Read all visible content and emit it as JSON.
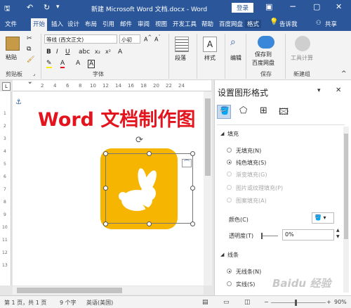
{
  "titlebar": {
    "title": "新建 Microsoft Word 文档.docx - Word",
    "login": "登录",
    "minimize_icon": "minimize-icon",
    "restore_icon": "restore-icon",
    "close_icon": "close-icon"
  },
  "tabs": [
    "文件",
    "开始",
    "插入",
    "设计",
    "布局",
    "引用",
    "邮件",
    "审阅",
    "视图",
    "开发工具",
    "帮助",
    "百度网盘",
    "格式"
  ],
  "tell_me": "告诉我",
  "share": "共享",
  "ribbon": {
    "paste": "粘贴",
    "clipboard": "剪贴板",
    "font_name": "等线 (西文正文)",
    "font_size": "小初",
    "font_group": "字体",
    "paragraph": "段落",
    "styles": "样式",
    "edit": "编辑",
    "save_to": "保存到",
    "baidu": "百度网盘",
    "save_group": "保存",
    "tools": "工具计算",
    "new_group": "新建组"
  },
  "document": {
    "heading": "Word 文档制作图",
    "heading_color": "#e3141d",
    "icon_bg": "#f6b500"
  },
  "ruler": {
    "marks": [
      "2",
      "4",
      "6",
      "8",
      "10",
      "12",
      "14",
      "16",
      "18",
      "20",
      "22",
      "24"
    ],
    "vmarks": [
      "1",
      "2",
      "3",
      "4",
      "5",
      "6",
      "7",
      "8",
      "9",
      "10",
      "11",
      "12",
      "13"
    ]
  },
  "pane": {
    "title": "设置图形格式",
    "fill_section": "填充",
    "fill_options": [
      {
        "label": "无填充(N)",
        "on": false,
        "disabled": false
      },
      {
        "label": "纯色填充(S)",
        "on": true,
        "disabled": false
      },
      {
        "label": "渐变填充(G)",
        "on": false,
        "disabled": true
      },
      {
        "label": "图片或纹理填充(P)",
        "on": false,
        "disabled": true
      },
      {
        "label": "图案填充(A)",
        "on": false,
        "disabled": true
      }
    ],
    "color_label": "颜色(C)",
    "transparency_label": "透明度(T)",
    "transparency_value": "0%",
    "line_section": "线条",
    "line_options": [
      {
        "label": "无线条(N)",
        "on": true
      },
      {
        "label": "实线(S)",
        "on": false
      }
    ]
  },
  "status": {
    "page": "第 1 页，共 1 页",
    "words": "9 个字",
    "lang": "英语(美国)",
    "zoom": "90%"
  },
  "watermark": "Baidu 经验"
}
